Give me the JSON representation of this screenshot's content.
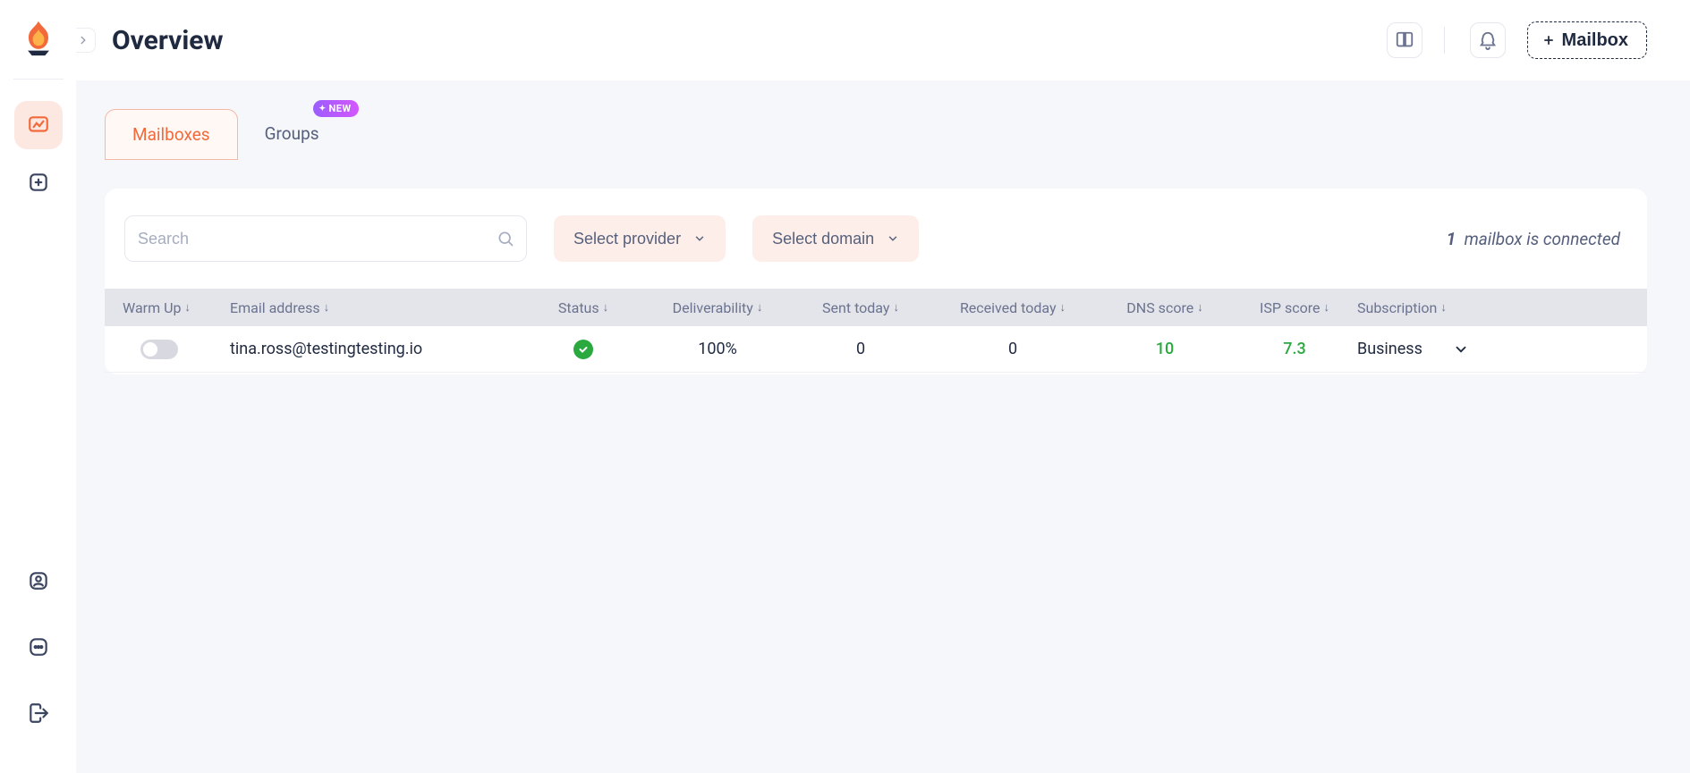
{
  "header": {
    "title": "Overview",
    "add_button_label": "Mailbox"
  },
  "tabs": {
    "mailboxes": "Mailboxes",
    "groups": "Groups",
    "groups_badge": "NEW"
  },
  "toolbar": {
    "search_placeholder": "Search",
    "provider_label": "Select provider",
    "domain_label": "Select domain",
    "connected_count": "1",
    "connected_text": "mailbox is connected"
  },
  "columns": {
    "warmup": "Warm Up",
    "email": "Email address",
    "status": "Status",
    "deliverability": "Deliverability",
    "sent": "Sent today",
    "received": "Received today",
    "dns": "DNS score",
    "isp": "ISP score",
    "subscription": "Subscription"
  },
  "rows": [
    {
      "email": "tina.ross@testingtesting.io",
      "deliverability": "100%",
      "sent": "0",
      "received": "0",
      "dns": "10",
      "isp": "7.3",
      "subscription": "Business"
    }
  ]
}
